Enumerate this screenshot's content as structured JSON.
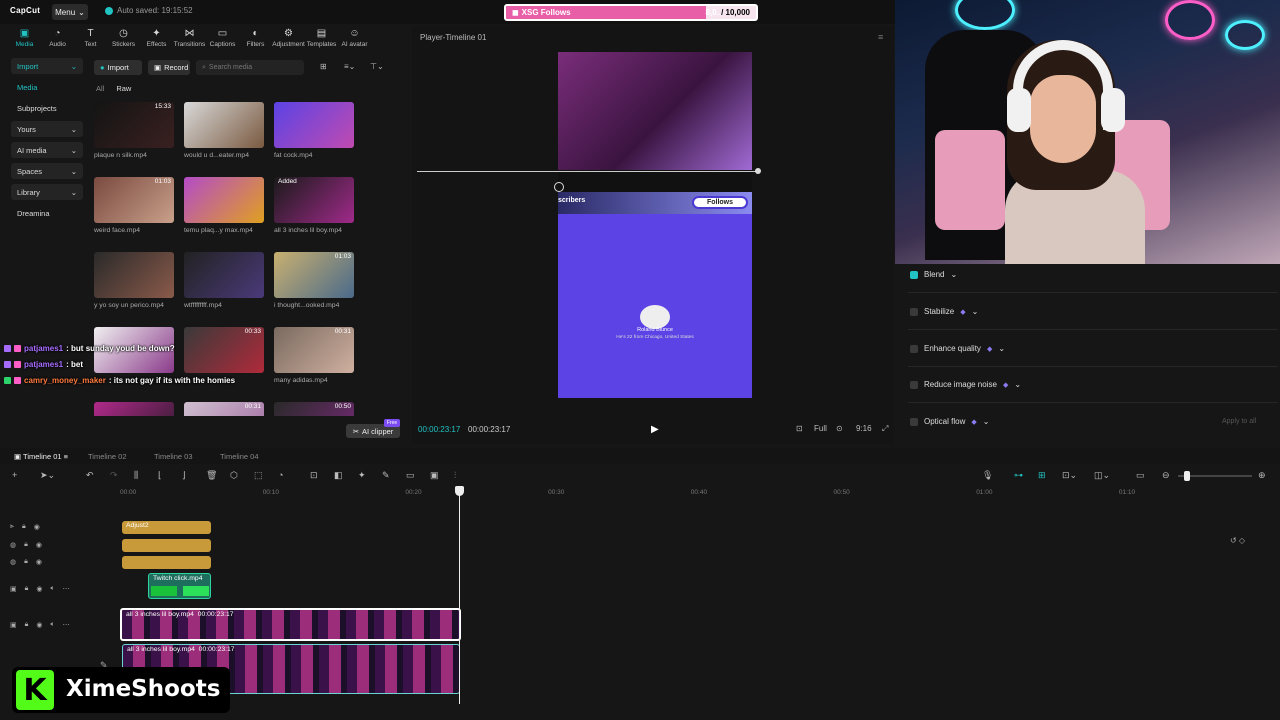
{
  "app": {
    "logo": "CapCut",
    "menu_label": "Menu",
    "autosave": "Auto saved: 19:15:52"
  },
  "goal": {
    "label": "XSG Follows",
    "current": "8,0..",
    "total": "/ 10,000",
    "progress": 0.8
  },
  "toolbar": [
    "Media",
    "Audio",
    "Text",
    "Stickers",
    "Effects",
    "Transitions",
    "Captions",
    "Filters",
    "Adjustment",
    "Templates",
    "AI avatar"
  ],
  "toolbar_icons": [
    "media-icon",
    "audio-icon",
    "text-icon",
    "stickers-icon",
    "effects-icon",
    "transitions-icon",
    "captions-icon",
    "filters-icon",
    "adjustment-icon",
    "templates-icon",
    "ai-avatar-icon"
  ],
  "sidenav": [
    {
      "label": "Import",
      "style": "sel"
    },
    {
      "label": "Media",
      "style": "sub"
    },
    {
      "label": "Subprojects",
      "style": "plain"
    },
    {
      "label": "Yours",
      "style": "dd"
    },
    {
      "label": "AI media",
      "style": "dd"
    },
    {
      "label": "Spaces",
      "style": "dd"
    },
    {
      "label": "Library",
      "style": "dd"
    },
    {
      "label": "Dreamina",
      "style": "plain"
    }
  ],
  "media": {
    "import_label": "Import",
    "record_label": "Record",
    "search_placeholder": "Search media",
    "filter_all": "All",
    "filter_raw": "Raw",
    "items": [
      {
        "name": "plaque n silk.mp4",
        "dur": "15:33",
        "c1": "#141414",
        "c2": "#3a2020"
      },
      {
        "name": "would u d...eater.mp4",
        "dur": "",
        "c1": "#d8d8d8",
        "c2": "#7a5a40"
      },
      {
        "name": "fat cock.mp4",
        "dur": "",
        "c1": "#5b43e5",
        "c2": "#c04bb0"
      },
      {
        "name": "weird face.mp4",
        "dur": "01:03",
        "c1": "#7a4a40",
        "c2": "#c9a08a"
      },
      {
        "name": "temu plaq...y max.mp4",
        "dur": "",
        "c1": "#b44bc8",
        "c2": "#e0a020"
      },
      {
        "name": "all 3 inches lil boy.mp4",
        "dur": "",
        "c1": "#1a1a1a",
        "c2": "#a02a8a",
        "added": "Added"
      },
      {
        "name": "y yo soy un perico.mp4",
        "dur": "",
        "c1": "#2a2a2a",
        "c2": "#8a5a4a"
      },
      {
        "name": "wtfffffffff.mp4",
        "dur": "",
        "c1": "#222",
        "c2": "#4a3a7a"
      },
      {
        "name": "i thought...ooked.mp4",
        "dur": "01:03",
        "c1": "#c9b070",
        "c2": "#4a6a8a"
      },
      {
        "name": "",
        "dur": "",
        "c1": "#f0f0f0",
        "c2": "#8a3a8a"
      },
      {
        "name": "",
        "dur": "00:33",
        "c1": "#3a3a3a",
        "c2": "#b02a3a"
      },
      {
        "name": "many adidas.mp4",
        "dur": "00:31",
        "c1": "#7a6a60",
        "c2": "#d0b0a0"
      },
      {
        "name": "",
        "dur": "",
        "c1": "#b02a8a",
        "c2": "#2a1a2a"
      },
      {
        "name": "",
        "dur": "00:31",
        "c1": "#d0c0d0",
        "c2": "#a06aa0"
      },
      {
        "name": "",
        "dur": "00:50",
        "c1": "#2a2a2a",
        "c2": "#7a2a7a"
      }
    ],
    "ai_clipper": "AI clipper",
    "ai_free": "Free"
  },
  "chat": [
    {
      "user": "patjames1",
      "msg": ": but sunday youd be down?",
      "color": "#a66cff"
    },
    {
      "user": "patjames1",
      "msg": ": bet",
      "color": "#a66cff"
    },
    {
      "user": "camry_money_maker",
      "msg": ": its not gay if its with the homies",
      "color": "#ff7a3d"
    }
  ],
  "player": {
    "title": "Player-Timeline 01",
    "follows_label": "Follows",
    "subscribers": "scribers",
    "profile_name": "Roland Blunce",
    "profile_bio": "He's 22 from Chicago, United States",
    "time_current": "00:00:23:17",
    "time_total": "00:00:23:17",
    "full_label": "Full",
    "ratio_label": "9:16"
  },
  "props": {
    "blend": "Blend",
    "stabilize": "Stabilize",
    "enhance": "Enhance quality",
    "reduce_noise": "Reduce image noise",
    "optical_flow": "Optical flow",
    "apply_all": "Apply to all"
  },
  "timeline": {
    "tabs": [
      "Timeline 01",
      "Timeline 02",
      "Timeline 03",
      "Timeline 04"
    ],
    "ruler": [
      "00:00",
      "00:10",
      "00:20",
      "00:30",
      "00:40",
      "00:50",
      "01:00",
      "01:10"
    ],
    "adjust_label": "Adjust2",
    "twitch_clip": "Twitch click.mp4",
    "video_clip": "all 3 inches lil boy.mp4",
    "video_dur": "00:00:23:17"
  },
  "brand": {
    "name": "XimeShoots",
    "logo_letter": "K"
  }
}
